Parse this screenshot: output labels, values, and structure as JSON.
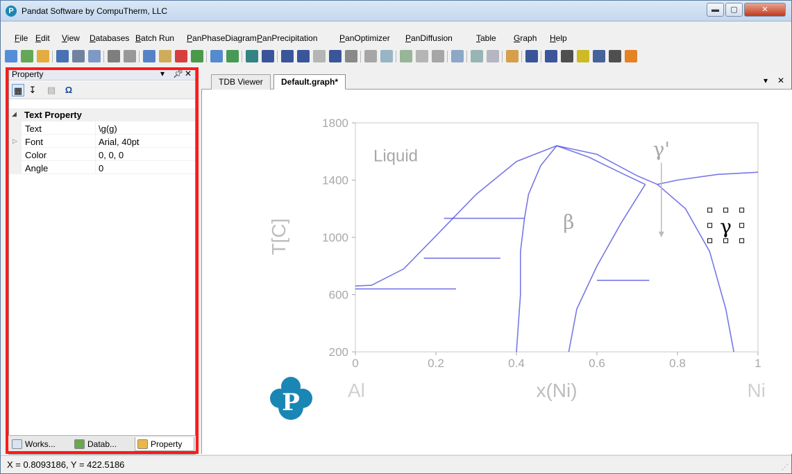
{
  "window": {
    "title": "Pandat Software by CompuTherm, LLC",
    "icon_letter": "P",
    "controls": [
      "minimize",
      "maximize",
      "close"
    ]
  },
  "menu": [
    {
      "label": "File",
      "key": "F"
    },
    {
      "label": "Edit",
      "key": "E"
    },
    {
      "label": "View",
      "key": "V"
    },
    {
      "label": "Databases",
      "key": "D"
    },
    {
      "label": "Batch Run",
      "key": "B"
    },
    {
      "label": "PanPhaseDiagram",
      "key": "P"
    },
    {
      "label": "PanPrecipitation",
      "key": "P"
    },
    {
      "label": "PanOptimizer",
      "key": "P"
    },
    {
      "label": "PanDiffusion",
      "key": "P"
    },
    {
      "label": "Table",
      "key": "T"
    },
    {
      "label": "Graph",
      "key": "G"
    },
    {
      "label": "Help",
      "key": "H"
    }
  ],
  "toolbar_icons": [
    "new-workspace",
    "new-window",
    "open-folder",
    "save",
    "save-all",
    "print-preview",
    "print",
    "cut",
    "copy",
    "paste",
    "delete",
    "import",
    "table-view",
    "download",
    "calculate",
    "point",
    "line",
    "section",
    "triangle",
    "fill",
    "copy-graph",
    "scatter",
    "plot-a",
    "plot-b",
    "plot-c",
    "grid",
    "layer",
    "chart",
    "zoom-region",
    "tools",
    "select-arrow",
    "zoom",
    "rotate",
    "edit-text",
    "legend",
    "text-insert",
    "pencil"
  ],
  "property_panel": {
    "title": "Property",
    "pin": "ᵖ",
    "close": "✕",
    "dropdown": "▾",
    "omega": "Ω",
    "category": "Text Property",
    "rows": [
      {
        "name": "Text",
        "value": "\\g(g)",
        "expandable": false
      },
      {
        "name": "Font",
        "value": "Arial, 40pt",
        "expandable": true
      },
      {
        "name": "Color",
        "value": "0, 0, 0",
        "expandable": false
      },
      {
        "name": "Angle",
        "value": "0",
        "expandable": false
      }
    ],
    "bottom_tabs": [
      {
        "label": "Works...",
        "icon": "workspace-icon",
        "active": false
      },
      {
        "label": "Datab...",
        "icon": "database-icon",
        "active": false
      },
      {
        "label": "Property",
        "icon": "property-icon",
        "active": true
      }
    ]
  },
  "document_tabs": [
    {
      "label": "TDB Viewer",
      "active": false
    },
    {
      "label": "Default.graph*",
      "active": true
    }
  ],
  "doc_controls": {
    "dropdown": "▾",
    "close": "✕"
  },
  "status": {
    "coords": "X = 0.8093186, Y = 422.5186"
  },
  "colors": {
    "highlight": "#ff1a1a",
    "curve": "#4a4adf",
    "logo": "#1a86b4",
    "axis_text": "#bdbdbd"
  },
  "chart_data": {
    "type": "line",
    "title": "",
    "xlabel": "x(Ni)",
    "ylabel": "T[C]",
    "xlim": [
      0,
      1
    ],
    "ylim": [
      200,
      1800
    ],
    "x_ticks": [
      "0",
      "0.2",
      "0.4",
      "0.6",
      "0.8",
      "1"
    ],
    "y_ticks": [
      "200",
      "600",
      "1000",
      "1400",
      "1800"
    ],
    "x_end_labels": {
      "left": "Al",
      "right": "Ni"
    },
    "annotations": [
      {
        "text": "Liquid",
        "x": 0.1,
        "y": 1530
      },
      {
        "text": "β",
        "x": 0.53,
        "y": 1060
      },
      {
        "text": "γ'",
        "x": 0.76,
        "y": 1570
      },
      {
        "text": "γ",
        "x": 0.92,
        "y": 1030
      }
    ],
    "selected_annotation": "γ",
    "series": [
      {
        "name": "liquidus_left",
        "points": [
          [
            0,
            660
          ],
          [
            0.04,
            665
          ],
          [
            0.12,
            780
          ],
          [
            0.2,
            1010
          ],
          [
            0.3,
            1300
          ],
          [
            0.4,
            1530
          ],
          [
            0.5,
            1640
          ]
        ]
      },
      {
        "name": "liquidus_right",
        "points": [
          [
            0.5,
            1640
          ],
          [
            0.6,
            1580
          ],
          [
            0.7,
            1430
          ],
          [
            0.75,
            1370
          ],
          [
            0.8,
            1400
          ],
          [
            0.9,
            1440
          ],
          [
            1,
            1455
          ]
        ]
      },
      {
        "name": "beta_solidus_left",
        "points": [
          [
            0.5,
            1640
          ],
          [
            0.46,
            1500
          ],
          [
            0.43,
            1300
          ],
          [
            0.42,
            1133
          ]
        ]
      },
      {
        "name": "beta_solidus_right",
        "points": [
          [
            0.5,
            1640
          ],
          [
            0.58,
            1560
          ],
          [
            0.66,
            1450
          ],
          [
            0.72,
            1370
          ]
        ]
      },
      {
        "name": "solvus_gamma",
        "points": [
          [
            0.75,
            1370
          ],
          [
            0.82,
            1200
          ],
          [
            0.88,
            900
          ],
          [
            0.92,
            500
          ],
          [
            0.94,
            200
          ]
        ]
      },
      {
        "name": "beta_low_ni",
        "points": [
          [
            0.42,
            1133
          ],
          [
            0.41,
            900
          ],
          [
            0.41,
            600
          ],
          [
            0.4,
            200
          ]
        ]
      },
      {
        "name": "beta_high_ni",
        "points": [
          [
            0.72,
            1370
          ],
          [
            0.66,
            1100
          ],
          [
            0.6,
            800
          ],
          [
            0.55,
            500
          ],
          [
            0.53,
            200
          ]
        ]
      },
      {
        "name": "peritectic_1",
        "points": [
          [
            0.17,
            854
          ],
          [
            0.36,
            854
          ]
        ]
      },
      {
        "name": "peritectic_2",
        "points": [
          [
            0.22,
            1133
          ],
          [
            0.42,
            1133
          ]
        ]
      },
      {
        "name": "eutectic",
        "points": [
          [
            0,
            640
          ],
          [
            0.25,
            640
          ]
        ]
      },
      {
        "name": "gamma_prime_line",
        "points": [
          [
            0.6,
            700
          ],
          [
            0.73,
            700
          ]
        ]
      }
    ]
  }
}
